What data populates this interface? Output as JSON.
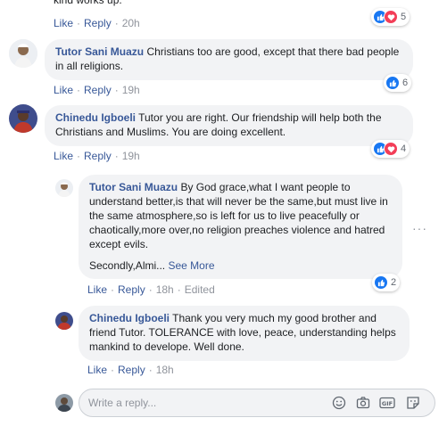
{
  "colors": {
    "name": "#385898",
    "bubble": "#f2f3f5",
    "like": "#1877f2",
    "love": "#f33e58"
  },
  "top": {
    "partial_text": "kind works up.",
    "like": "Like",
    "reply": "Reply",
    "time": "20h",
    "reaction_count": "5",
    "reactions": [
      "like-icon",
      "love-icon"
    ]
  },
  "comments": [
    {
      "author": "Tutor Sani Muazu",
      "text": "Christians too are good, except that there bad people in all religions.",
      "like": "Like",
      "reply": "Reply",
      "time": "19h",
      "reaction_count": "6",
      "reactions": [
        "like-icon"
      ]
    },
    {
      "author": "Chinedu Igboeli",
      "text": "Tutor you are right. Our friendship will help both the Christians and Muslims. You are doing excellent.",
      "like": "Like",
      "reply": "Reply",
      "time": "19h",
      "reaction_count": "4",
      "reactions": [
        "like-icon",
        "love-icon"
      ]
    }
  ],
  "replies": [
    {
      "author": "Tutor Sani Muazu",
      "text": "By God grace,what I want people to understand better,is that will never be the same,but must live in the same atmosphere,so is left for us to live peacefully or chaotically,more over,no religion preaches violence and hatred except evils.",
      "text2": "Secondly,Almi...",
      "see_more": "See More",
      "like": "Like",
      "reply": "Reply",
      "time": "18h",
      "edited": "Edited",
      "reaction_count": "2",
      "reactions": [
        "like-icon"
      ]
    },
    {
      "author": "Chinedu Igboeli",
      "text": "Thank you very much my good brother and friend Tutor. TOLERANCE with love, peace, understanding helps mankind to develope. Well done.",
      "like": "Like",
      "reply": "Reply",
      "time": "18h"
    }
  ],
  "reply_box": {
    "placeholder": "Write a reply...",
    "tools": [
      "emoji-icon",
      "camera-icon",
      "gif-icon",
      "sticker-icon"
    ]
  }
}
